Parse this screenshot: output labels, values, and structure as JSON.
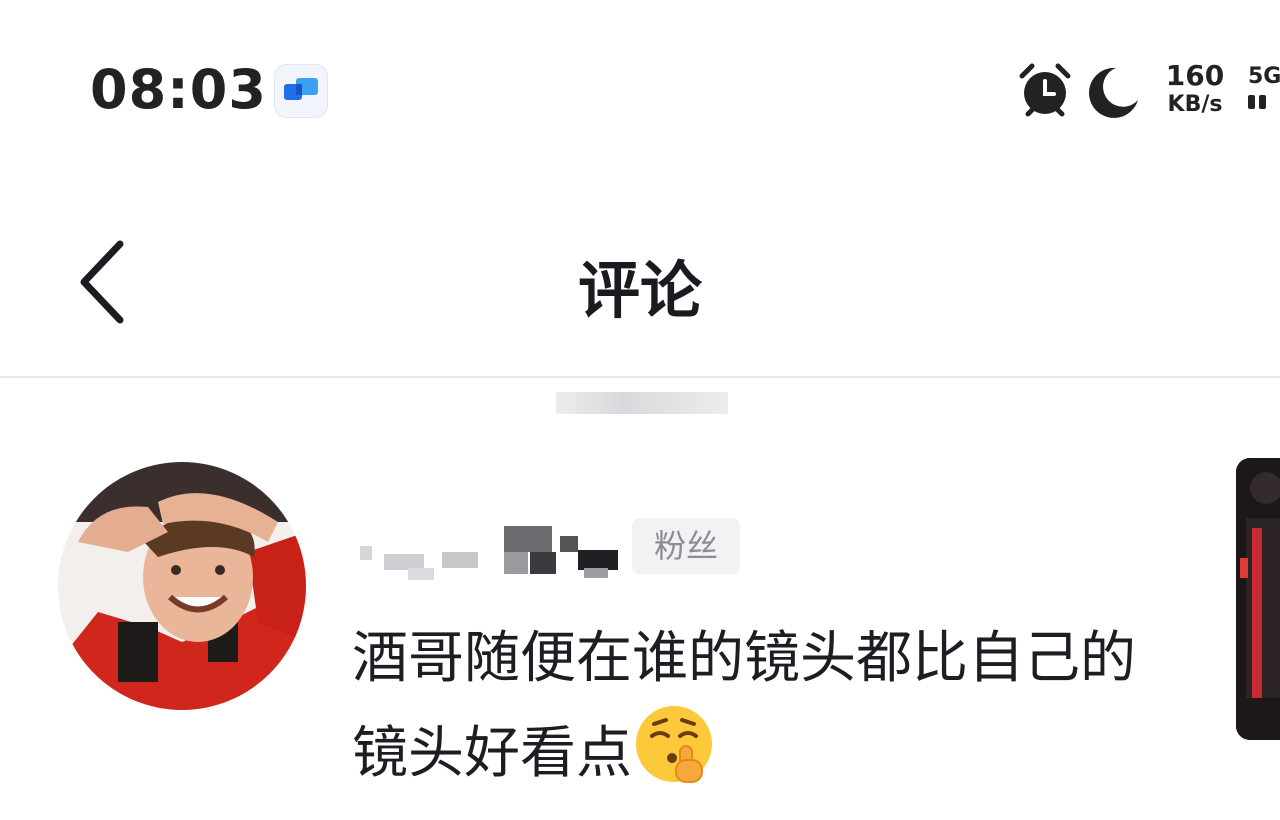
{
  "status_bar": {
    "time": "08:03",
    "net_speed_value": "160",
    "net_speed_unit": "KB/s",
    "network_type": "5G",
    "icons": [
      "chat-app-icon",
      "alarm-icon",
      "moon-icon",
      "signal-icon"
    ]
  },
  "header": {
    "back_icon": "chevron-left-icon",
    "title": "评论"
  },
  "comment": {
    "badge": "粉丝",
    "text": "酒哥随便在谁的镜头都比自己的镜头好看点",
    "emoji": "shushing-face-emoji"
  }
}
